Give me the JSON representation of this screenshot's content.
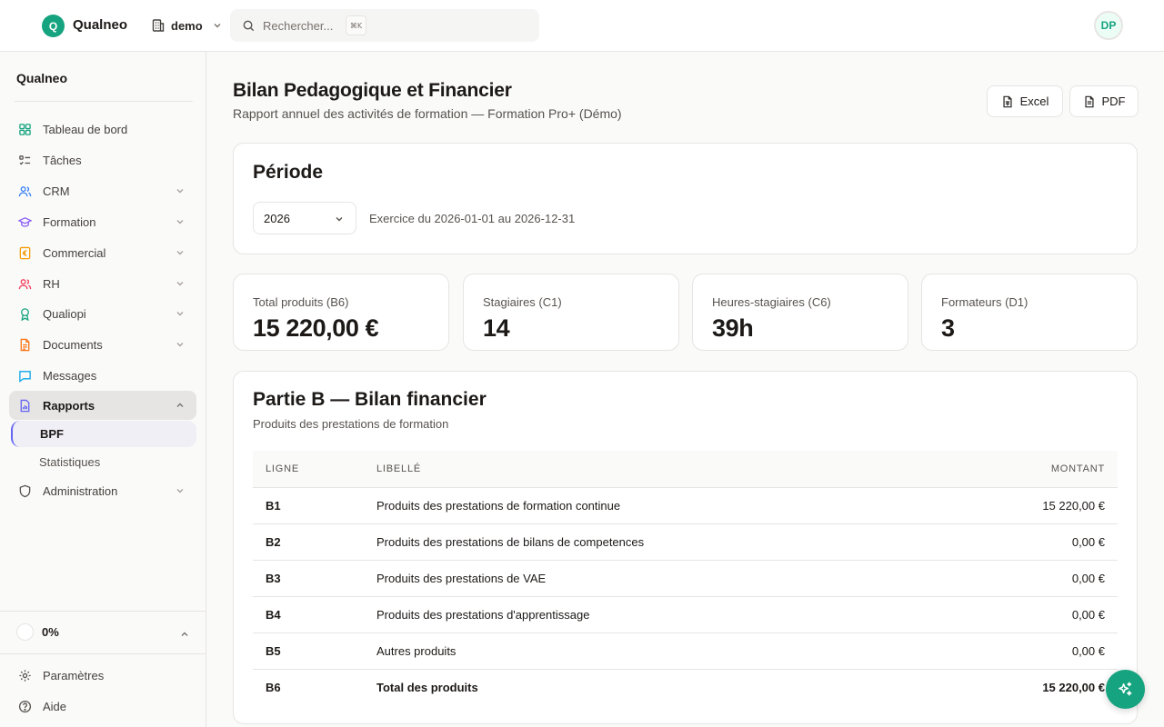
{
  "app": {
    "logo_letter": "Q",
    "brand": "Qualneo",
    "org": "demo",
    "search_placeholder": "Rechercher...",
    "search_shortcut": "⌘K",
    "user_initials": "DP"
  },
  "sidebar": {
    "title": "Qualneo",
    "items": [
      {
        "label": "Tableau de bord",
        "icon": "dashboard-icon",
        "color": "#16a37f"
      },
      {
        "label": "Tâches",
        "icon": "tasks-icon",
        "color": "#57534e"
      },
      {
        "label": "CRM",
        "icon": "users-icon",
        "color": "#3b82f6"
      },
      {
        "label": "Formation",
        "icon": "graduation-cap-icon",
        "color": "#8b5cf6"
      },
      {
        "label": "Commercial",
        "icon": "euro-icon",
        "color": "#f59e0b"
      },
      {
        "label": "RH",
        "icon": "users-icon",
        "color": "#f43f5e"
      },
      {
        "label": "Qualiopi",
        "icon": "award-icon",
        "color": "#16a37f"
      },
      {
        "label": "Documents",
        "icon": "document-icon",
        "color": "#f97316"
      },
      {
        "label": "Messages",
        "icon": "message-icon",
        "color": "#0ea5e9"
      },
      {
        "label": "Rapports",
        "icon": "report-icon",
        "color": "#6366f1"
      },
      {
        "label": "Administration",
        "icon": "shield-icon",
        "color": "#57534e"
      }
    ],
    "sub_items": [
      "BPF",
      "Statistiques"
    ],
    "progress": "0%",
    "footer": [
      "Paramètres",
      "Aide"
    ]
  },
  "header": {
    "title": "Bilan Pedagogique et Financier",
    "subtitle": "Rapport annuel des activités de formation — Formation Pro+ (Démo)",
    "excel_label": "Excel",
    "pdf_label": "PDF"
  },
  "period": {
    "title": "Période",
    "year": "2026",
    "note": "Exercice du 2026-01-01 au 2026-12-31"
  },
  "stats": [
    {
      "label": "Total produits (B6)",
      "value": "15 220,00 €"
    },
    {
      "label": "Stagiaires (C1)",
      "value": "14"
    },
    {
      "label": "Heures-stagiaires (C6)",
      "value": "39h"
    },
    {
      "label": "Formateurs (D1)",
      "value": "3"
    }
  ],
  "partb": {
    "title": "Partie B — Bilan financier",
    "subtitle": "Produits des prestations de formation",
    "columns": [
      "LIGNE",
      "LIBELLÉ",
      "MONTANT"
    ],
    "rows": [
      {
        "code": "B1",
        "label": "Produits des prestations de formation continue",
        "amount": "15 220,00 €"
      },
      {
        "code": "B2",
        "label": "Produits des prestations de bilans de competences",
        "amount": "0,00 €"
      },
      {
        "code": "B3",
        "label": "Produits des prestations de VAE",
        "amount": "0,00 €"
      },
      {
        "code": "B4",
        "label": "Produits des prestations d'apprentissage",
        "amount": "0,00 €"
      },
      {
        "code": "B5",
        "label": "Autres produits",
        "amount": "0,00 €"
      },
      {
        "code": "B6",
        "label": "Total des produits",
        "amount": "15 220,00 €"
      }
    ]
  },
  "colors": {
    "accent": "#16a37f",
    "active_indicator": "#6366f1"
  }
}
